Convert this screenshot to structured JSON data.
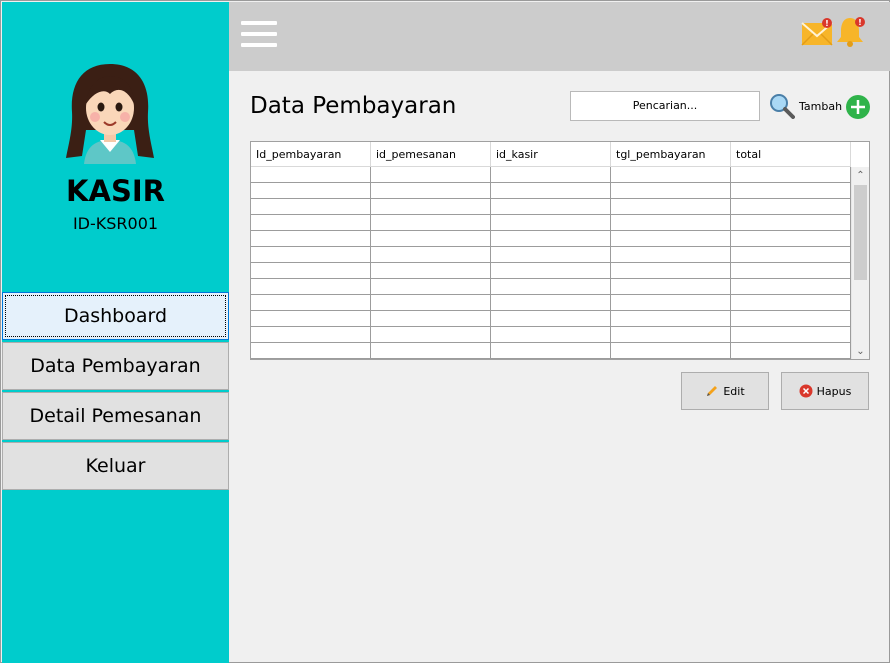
{
  "sidebar": {
    "role": "KASIR",
    "user_id": "ID-KSR001",
    "nav": [
      {
        "label": "Dashboard",
        "active": true
      },
      {
        "label": "Data Pembayaran",
        "active": false
      },
      {
        "label": "Detail Pemesanan",
        "active": false
      },
      {
        "label": "Keluar",
        "active": false
      }
    ]
  },
  "topbar": {
    "menu_icon": "hamburger-menu-icon",
    "mail_icon": "mail-notification-icon",
    "bell_icon": "bell-notification-icon",
    "mail_badge": "!",
    "bell_badge": "!"
  },
  "main": {
    "title": "Data Pembayaran",
    "search_placeholder": "Pencarian...",
    "add_label": "Tambah",
    "table": {
      "columns": [
        "Id_pembayaran",
        "id_pemesanan",
        "id_kasir",
        "tgl_pembayaran",
        "total"
      ],
      "rows": []
    },
    "edit_label": "Edit",
    "delete_label": "Hapus"
  },
  "colors": {
    "sidebar": "#00cccc",
    "topbar": "#cccccc",
    "add_green": "#2fb34a",
    "delete_red": "#d9372b"
  }
}
